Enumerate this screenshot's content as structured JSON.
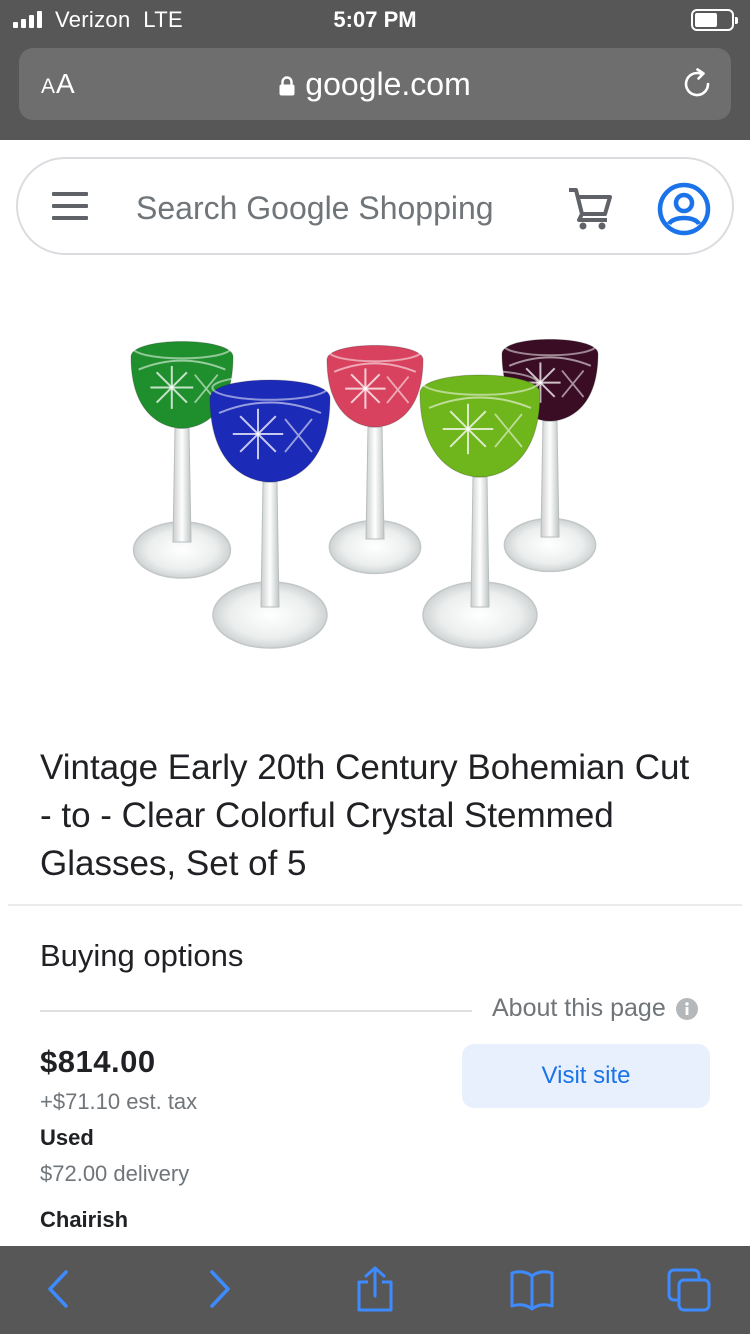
{
  "status_bar": {
    "carrier": "Verizon  LTE",
    "time": "5:07 PM"
  },
  "browser": {
    "text_size_small": "A",
    "text_size_large": "A",
    "url": "google.com"
  },
  "search": {
    "placeholder": "Search Google Shopping"
  },
  "product": {
    "image_icon": "crystal-wine-glasses",
    "glass_colors": [
      "#1e8f2c",
      "#1c2ab8",
      "#d8425e",
      "#6fb51c",
      "#3a0d24"
    ],
    "title": "Vintage Early 20th Century Bohemian Cut - to - Clear Colorful Crystal Stemmed Glasses, Set of 5"
  },
  "buying_options": {
    "heading": "Buying options",
    "about_link": "About this page",
    "offers": [
      {
        "price": "$814.00",
        "tax": "+$71.10 est. tax",
        "condition": "Used",
        "delivery": "$72.00 delivery",
        "seller": "Chairish",
        "button_label": "Visit site"
      }
    ]
  },
  "toolbar": {
    "icons": [
      "back-icon",
      "forward-icon",
      "share-icon",
      "bookmarks-icon",
      "tabs-icon"
    ]
  },
  "colors": {
    "chrome_bg": "#575757",
    "accent_blue": "#1a73e8",
    "button_bg": "#e8f0fe",
    "ios_blue": "#3d8bff"
  }
}
